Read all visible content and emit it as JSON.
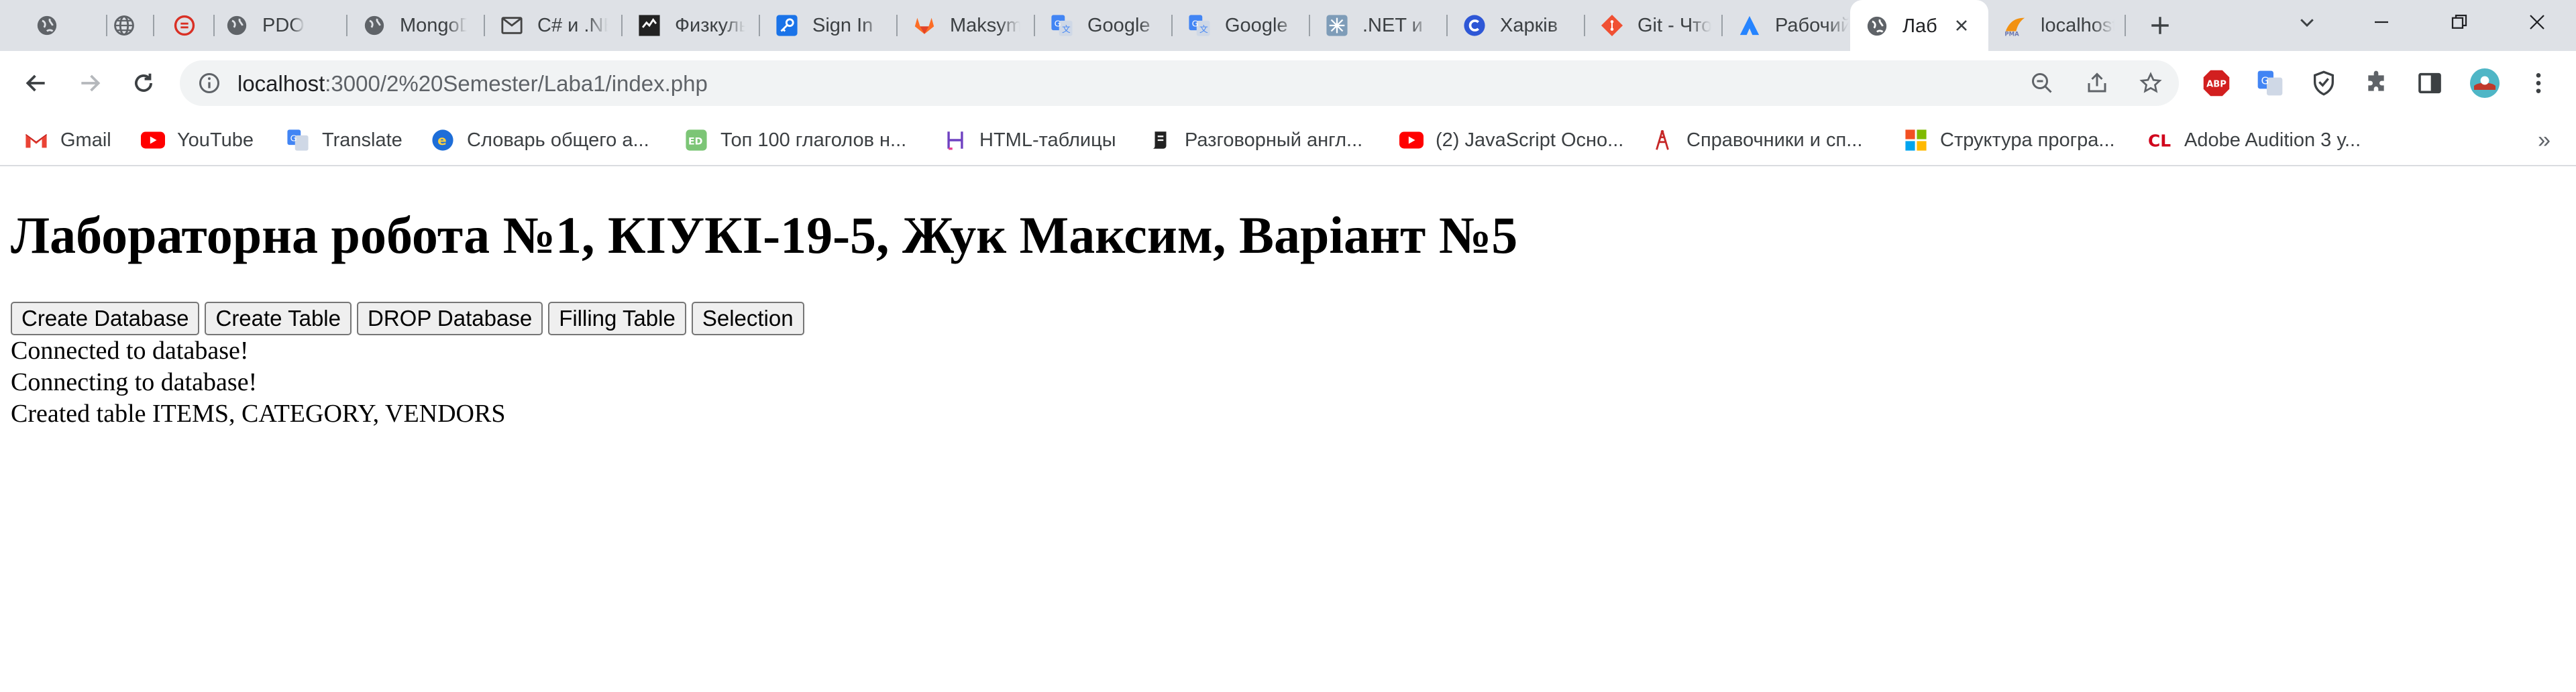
{
  "tabs": [
    {
      "title": "",
      "icon": "globe-icon"
    },
    {
      "title": "",
      "icon": "globe-icon"
    },
    {
      "title": "",
      "icon": "no-entry-icon"
    },
    {
      "title": "PDO",
      "icon": "globe-icon"
    },
    {
      "title": "MongoDB",
      "icon": "globe-icon"
    },
    {
      "title": "C# и .NET",
      "icon": "gmail-icon"
    },
    {
      "title": "Физкультура",
      "icon": "fitness-icon"
    },
    {
      "title": "Sign In",
      "icon": "key-icon"
    },
    {
      "title": "Maksym",
      "icon": "gitlab-icon"
    },
    {
      "title": "Google",
      "icon": "google-translate-icon"
    },
    {
      "title": "Google",
      "icon": "google-translate-icon"
    },
    {
      "title": ".NET и",
      "icon": "dotnet-icon"
    },
    {
      "title": "Харків",
      "icon": "c-logo-icon"
    },
    {
      "title": "Git - Что",
      "icon": "git-icon"
    },
    {
      "title": "Рабочий",
      "icon": "atlassian-icon"
    },
    {
      "title": "Лаб",
      "icon": "globe-icon",
      "active": true
    },
    {
      "title": "localhost",
      "icon": "phpmyadmin-icon"
    }
  ],
  "address": {
    "host": "localhost",
    "path": ":3000/2%20Semester/Laba1/index.php"
  },
  "bookmarks": [
    {
      "label": "Gmail",
      "icon": "gmail-icon"
    },
    {
      "label": "YouTube",
      "icon": "youtube-icon"
    },
    {
      "label": "Translate",
      "icon": "google-translate-icon"
    },
    {
      "label": "Словарь общего а...",
      "icon": "e-icon"
    },
    {
      "label": "Топ 100 глаголов н...",
      "icon": "ed-icon"
    },
    {
      "label": "HTML-таблицы",
      "icon": "html-icon"
    },
    {
      "label": "Разговорный англ...",
      "icon": "scroll-icon"
    },
    {
      "label": "(2) JavaScript Осно...",
      "icon": "youtube-icon"
    },
    {
      "label": "Справочники и сп...",
      "icon": "tower-icon"
    },
    {
      "label": "Структура програ...",
      "icon": "microsoft-icon"
    },
    {
      "label": "Adobe Audition 3 у...",
      "icon": "cl-icon"
    }
  ],
  "page": {
    "heading": "Лабораторна робота №1, КІУКІ-19-5, Жук Максим, Варіант №5",
    "buttons": [
      "Create Database",
      "Create Table",
      "DROP Database",
      "Filling Table",
      "Selection"
    ],
    "messages": [
      "Connected to database!",
      "Connecting to database!",
      "Created table ITEMS, CATEGORY, VENDORS"
    ]
  },
  "colors": {
    "tabstrip": "#dee1e6",
    "omnibox": "#f1f3f4",
    "youtube": "#ff0000",
    "gitlab": "#fc6d26",
    "abp": "#d21f1f"
  }
}
